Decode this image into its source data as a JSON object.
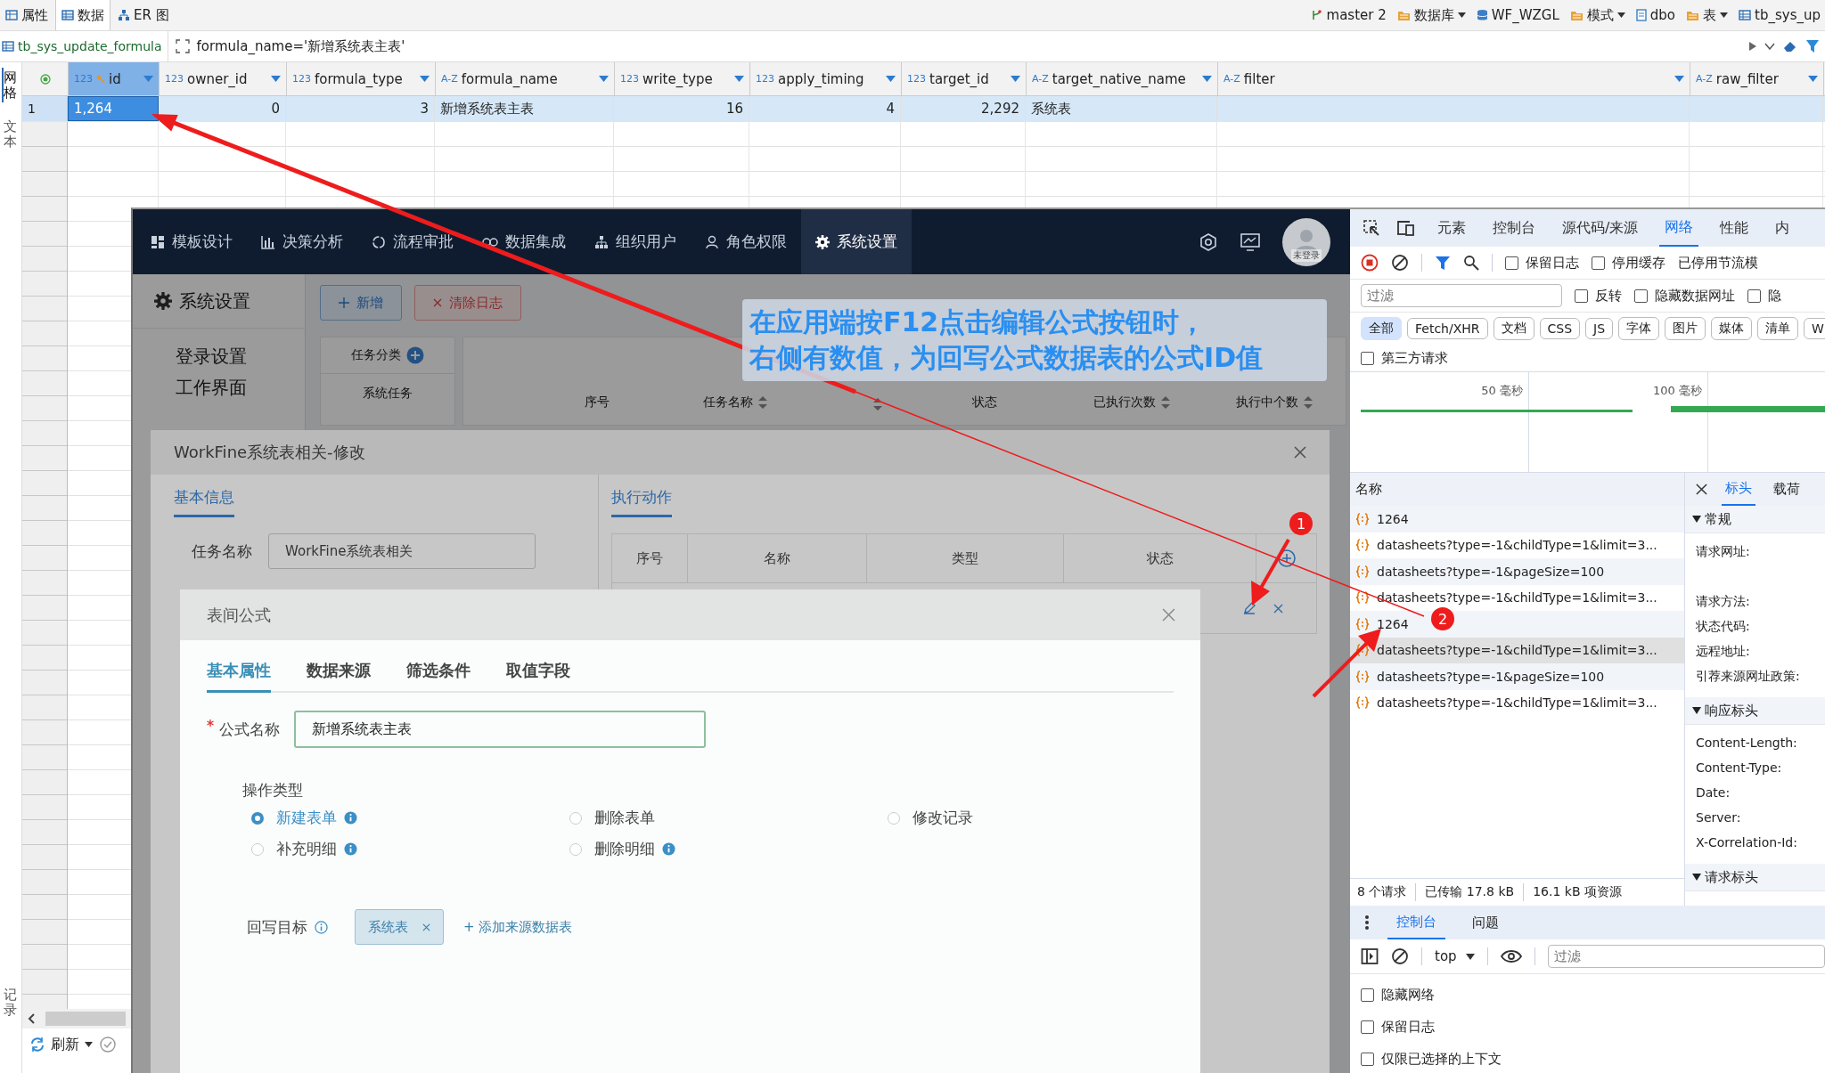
{
  "toolbar": {
    "tabs": [
      {
        "label": "属性",
        "selected": false,
        "kind": "props"
      },
      {
        "label": "数据",
        "selected": true,
        "kind": "data"
      },
      {
        "label": "ER 图",
        "selected": false,
        "kind": "er"
      }
    ],
    "context": [
      {
        "label": "master 2",
        "dropdown": false,
        "kind": "branch"
      },
      {
        "label": "数据库",
        "dropdown": true,
        "kind": "folder"
      },
      {
        "label": "WF_WZGL",
        "dropdown": false,
        "kind": "database"
      },
      {
        "label": "模式",
        "dropdown": true,
        "kind": "folder"
      },
      {
        "label": "dbo",
        "dropdown": false,
        "kind": "schema"
      },
      {
        "label": "表",
        "dropdown": true,
        "kind": "folder"
      },
      {
        "label": "tb_sys_up",
        "dropdown": false,
        "kind": "table"
      }
    ]
  },
  "filter_bar": {
    "table": "tb_sys_update_formula",
    "expression": "formula_name='新增系统表主表'"
  },
  "side_tabs": [
    {
      "label": "网格",
      "selected": true
    },
    {
      "label": "文本",
      "selected": false
    },
    {
      "label": "记录",
      "selected": false
    }
  ],
  "grid": {
    "columns": [
      {
        "type": "123",
        "name": "id",
        "kind": "number",
        "key": true,
        "selected": true
      },
      {
        "type": "123",
        "name": "owner_id",
        "kind": "number",
        "key": false,
        "selected": false
      },
      {
        "type": "123",
        "name": "formula_type",
        "kind": "number",
        "key": false,
        "selected": false
      },
      {
        "type": "A-Z",
        "name": "formula_name",
        "kind": "text",
        "key": false,
        "selected": false
      },
      {
        "type": "123",
        "name": "write_type",
        "kind": "number",
        "key": false,
        "selected": false
      },
      {
        "type": "123",
        "name": "apply_timing",
        "kind": "number",
        "key": false,
        "selected": false
      },
      {
        "type": "123",
        "name": "target_id",
        "kind": "number",
        "key": false,
        "selected": false
      },
      {
        "type": "A-Z",
        "name": "target_native_name",
        "kind": "text",
        "key": false,
        "selected": false
      },
      {
        "type": "A-Z",
        "name": "filter",
        "kind": "text",
        "key": false,
        "selected": false
      },
      {
        "type": "A-Z",
        "name": "raw_filter",
        "kind": "text",
        "key": false,
        "selected": false
      }
    ],
    "rows": [
      {
        "number": "1",
        "cells": [
          {
            "text": "1,264",
            "selected": true
          },
          {
            "text": "0",
            "selected": false
          },
          {
            "text": "3",
            "selected": false
          },
          {
            "text": "新增系统表主表",
            "selected": false
          },
          {
            "text": "16",
            "selected": false
          },
          {
            "text": "4",
            "selected": false
          },
          {
            "text": "2,292",
            "selected": false
          },
          {
            "text": "系统表",
            "selected": false
          }
        ]
      }
    ]
  },
  "bottom_bar": {
    "refresh": "刷新"
  },
  "app": {
    "nav": [
      {
        "label": "模板设计",
        "kind": "grid",
        "selected": false
      },
      {
        "label": "决策分析",
        "kind": "chart",
        "selected": false
      },
      {
        "label": "流程审批",
        "kind": "flow",
        "selected": false
      },
      {
        "label": "数据集成",
        "kind": "link",
        "selected": false
      },
      {
        "label": "组织用户",
        "kind": "org",
        "selected": false
      },
      {
        "label": "角色权限",
        "kind": "user",
        "selected": false
      },
      {
        "label": "系统设置",
        "kind": "gear",
        "selected": true
      }
    ],
    "avatar_label": "未登录",
    "page_title": "系统设置",
    "menu": [
      "登录设置",
      "工作界面"
    ],
    "buttons": [
      {
        "label": "新增",
        "kind": "add"
      },
      {
        "label": "清除日志",
        "kind": "clear"
      }
    ],
    "category": {
      "title": "任务分类",
      "item": "系统任务"
    },
    "table_columns": [
      {
        "label": "序号",
        "sortable": false
      },
      {
        "label": "任务名称",
        "sortable": true
      },
      {
        "sortable": true
      },
      {
        "label": "状态",
        "sortable": false
      },
      {
        "label": "已执行次数",
        "sortable": true
      },
      {
        "label": "执行中个数",
        "sortable": true
      }
    ]
  },
  "task_dialog": {
    "title": "WorkFine系统表相关-修改",
    "left_section": "基本信息",
    "right_section": "执行动作",
    "field": {
      "label": "任务名称",
      "value": "WorkFine系统表相关"
    },
    "columns": [
      "序号",
      "名称",
      "类型",
      "状态"
    ]
  },
  "formula_dialog": {
    "title": "表间公式",
    "tabs": [
      {
        "label": "基本属性",
        "selected": true
      },
      {
        "label": "数据来源",
        "selected": false
      },
      {
        "label": "筛选条件",
        "selected": false
      },
      {
        "label": "取值字段",
        "selected": false
      }
    ],
    "name_field": {
      "label": "公式名称",
      "required": true,
      "value": "新增系统表主表"
    },
    "op_label": "操作类型",
    "options": [
      {
        "label": "新建表单",
        "selected": true,
        "info": true
      },
      {
        "label": "删除表单",
        "selected": false,
        "info": false
      },
      {
        "label": "修改记录",
        "selected": false,
        "info": false
      },
      {
        "label": "补充明细",
        "selected": false,
        "info": true
      },
      {
        "label": "删除明细",
        "selected": false,
        "info": true
      }
    ],
    "target_label": "回写目标",
    "targets": [
      "系统表"
    ],
    "add_link": "+ 添加来源数据表"
  },
  "callout": [
    "在应用端按F12点击编辑公式按钮时，",
    "右侧有数值，为回写公式数据表的公式ID值"
  ],
  "badges": [
    "1",
    "2"
  ],
  "devtools": {
    "tabs": [
      {
        "label": "元素",
        "selected": false
      },
      {
        "label": "控制台",
        "selected": false
      },
      {
        "label": "源代码/来源",
        "selected": false
      },
      {
        "label": "网络",
        "selected": true
      },
      {
        "label": "性能",
        "selected": false
      },
      {
        "label": "内",
        "selected": false
      }
    ],
    "toolbar_checks": [
      {
        "label": "保留日志",
        "checked": false
      },
      {
        "label": "停用缓存",
        "checked": false
      }
    ],
    "throttle": "已停用节流模",
    "filter_placeholder": "过滤",
    "filter_checks": [
      {
        "label": "反转",
        "checked": false
      },
      {
        "label": "隐藏数据网址",
        "checked": false
      },
      {
        "label": "隐",
        "checked": false
      }
    ],
    "types": [
      {
        "label": "全部",
        "selected": true
      },
      {
        "label": "Fetch/XHR",
        "selected": false
      },
      {
        "label": "文档",
        "selected": false
      },
      {
        "label": "CSS",
        "selected": false
      },
      {
        "label": "JS",
        "selected": false
      },
      {
        "label": "字体",
        "selected": false
      },
      {
        "label": "图片",
        "selected": false
      },
      {
        "label": "媒体",
        "selected": false
      },
      {
        "label": "清单",
        "selected": false
      },
      {
        "label": "W",
        "selected": false
      }
    ],
    "third_party": {
      "label": "第三方请求",
      "checked": false
    },
    "timeline_ticks": [
      "50 毫秒",
      "100 毫秒"
    ],
    "name_header": "名称",
    "requests": [
      {
        "name": "1264",
        "selected": false
      },
      {
        "name": "datasheets?type=-1&childType=1&limit=3...",
        "selected": false
      },
      {
        "name": "datasheets?type=-1&pageSize=100",
        "selected": false
      },
      {
        "name": "datasheets?type=-1&childType=1&limit=3...",
        "selected": false
      },
      {
        "name": "1264",
        "selected": false
      },
      {
        "name": "datasheets?type=-1&childType=1&limit=3...",
        "selected": true
      },
      {
        "name": "datasheets?type=-1&pageSize=100",
        "selected": false
      },
      {
        "name": "datasheets?type=-1&childType=1&limit=3...",
        "selected": false
      }
    ],
    "detail_tabs": [
      {
        "label": "标头",
        "selected": true
      },
      {
        "label": "载荷",
        "selected": false
      }
    ],
    "sections": [
      {
        "title": "常规",
        "fields": [
          "请求网址:",
          "请求方法:",
          "状态代码:",
          "远程地址:",
          "引荐来源网址政策:"
        ]
      },
      {
        "title": "响应标头",
        "fields": [
          "Content-Length:",
          "Content-Type:",
          "Date:",
          "Server:",
          "X-Correlation-Id:"
        ]
      },
      {
        "title": "请求标头"
      }
    ],
    "summary": [
      "8 个请求",
      "已传输 17.8 kB",
      "16.1 kB 项资源"
    ],
    "drawer": {
      "tabs": [
        {
          "label": "控制台",
          "selected": true
        },
        {
          "label": "问题",
          "selected": false
        }
      ],
      "context": "top",
      "filter_placeholder": "过滤",
      "options": [
        {
          "label": "隐藏网络",
          "checked": false
        },
        {
          "label": "保留日志",
          "checked": false
        },
        {
          "label": "仅限已选择的上下文",
          "checked": false
        }
      ]
    }
  }
}
